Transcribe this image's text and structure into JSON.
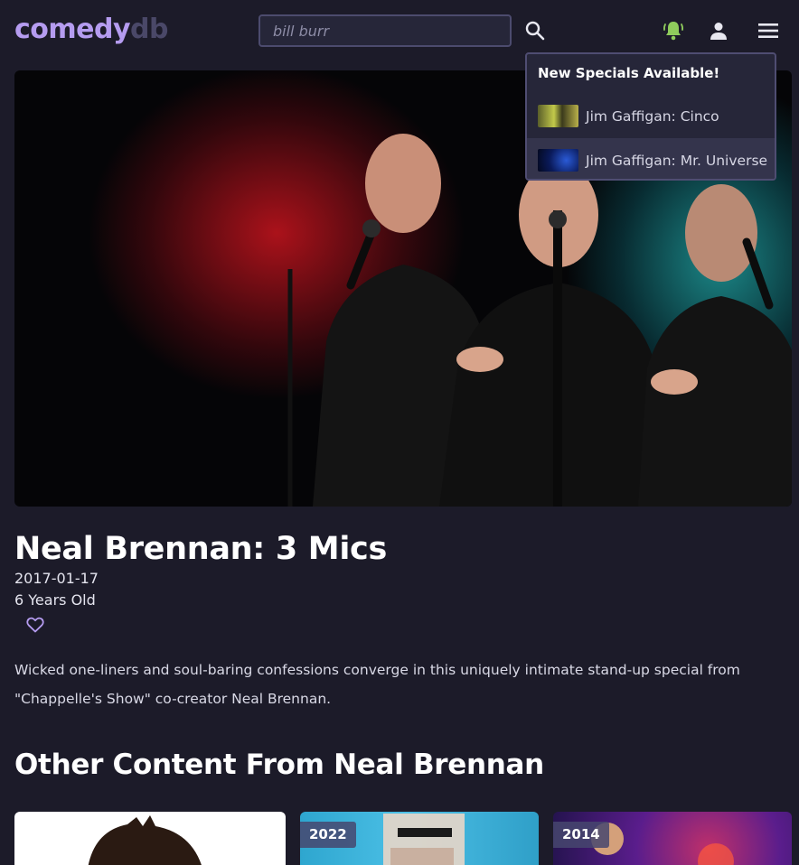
{
  "header": {
    "logo_primary": "comedy",
    "logo_secondary": "db",
    "search_placeholder": "bill burr",
    "icons": {
      "search": "search-icon",
      "notifications": "bell-icon",
      "account": "user-icon",
      "menu": "hamburger-menu-icon"
    },
    "colors": {
      "logo_primary": "#b59cf0",
      "logo_secondary": "#4a4868",
      "bell": "#8fcc5c"
    }
  },
  "notifications": {
    "title": "New Specials Available!",
    "items": [
      {
        "label": "Jim Gaffigan: Cinco"
      },
      {
        "label": "Jim Gaffigan: Mr. Universe"
      }
    ]
  },
  "special": {
    "title": "Neal Brennan: 3 Mics",
    "date": "2017-01-17",
    "age": "6 Years Old",
    "favorite_icon": "heart-outline-icon",
    "description": "Wicked one-liners and soul-baring confessions converge in this uniquely intimate stand-up special from \"Chappelle's Show\" co-creator Neal Brennan."
  },
  "other_content": {
    "heading": "Other Content From Neal Brennan",
    "cards": [
      {
        "year": ""
      },
      {
        "year": "2022"
      },
      {
        "year": "2014"
      }
    ]
  }
}
